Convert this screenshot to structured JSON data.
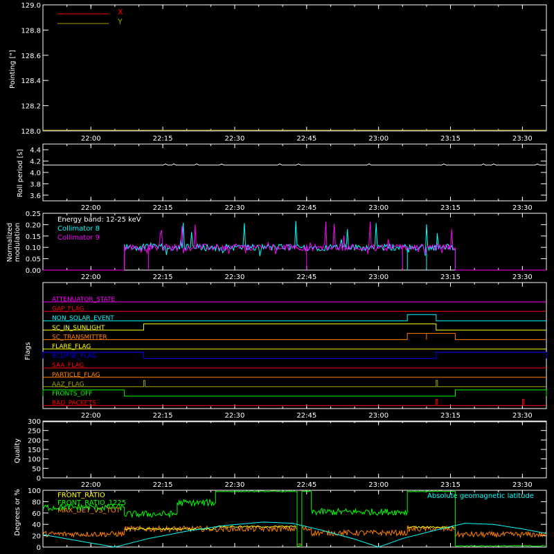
{
  "colors": {
    "background": "#000000",
    "axes": "#ffffff",
    "red": "#ff0000",
    "olive": "#a0a000",
    "cyan": "#00ffff",
    "magenta": "#ff00ff",
    "yellow": "#ffff00",
    "orange": "#ff8000",
    "blue": "#0000ff",
    "green": "#00ff00",
    "white": "#ffffff"
  },
  "time_axis": {
    "range": [
      "21:50",
      "23:35"
    ],
    "tick_labels": [
      "22:00",
      "22:15",
      "22:30",
      "22:45",
      "23:00",
      "23:15",
      "23:30"
    ]
  },
  "chart_data": [
    {
      "type": "line",
      "panel": "pointing",
      "ylabel": "Pointing [\"]",
      "ylim": [
        128.0,
        129.0
      ],
      "yticks": [
        "128.0",
        "128.2",
        "128.4",
        "128.6",
        "128.8",
        "129.0"
      ],
      "legend_placement": "top-left",
      "series": [
        {
          "name": "X",
          "color": "#ff0000",
          "points": []
        },
        {
          "name": "Y",
          "color": "#a0a000",
          "points": [
            [
              "21:50",
              128.0
            ],
            [
              "23:35",
              128.0
            ]
          ]
        }
      ]
    },
    {
      "type": "line",
      "panel": "roll",
      "ylabel": "Roll period [s]",
      "ylim": [
        3.5,
        4.5
      ],
      "yticks": [
        "3.6",
        "3.8",
        "4.0",
        "4.2",
        "4.4"
      ],
      "series": [
        {
          "name": "",
          "color": "#ffffff",
          "points": [
            [
              "21:50",
              4.13
            ],
            [
              "23:35",
              4.13
            ]
          ]
        }
      ]
    },
    {
      "type": "line",
      "panel": "modulation",
      "ylabel": [
        "Normalized",
        "modulation"
      ],
      "ylim": [
        0.0,
        0.25
      ],
      "yticks": [
        "0.00",
        "0.05",
        "0.10",
        "0.15",
        "0.20",
        "0.25"
      ],
      "annotation": "Energy band: 12-25 keV",
      "legend_placement": "top-left",
      "active_range": [
        "22:07",
        "23:16"
      ],
      "series": [
        {
          "name": "Collimator 8",
          "color": "#00ffff",
          "baseline": 0.1,
          "dropouts": [
            "23:06",
            "23:10"
          ]
        },
        {
          "name": "Collimator 9",
          "color": "#ff00ff",
          "baseline": 0.1,
          "dropouts": [
            "22:07",
            "22:12",
            "22:45",
            "23:05"
          ]
        }
      ]
    },
    {
      "type": "line",
      "panel": "flags",
      "ylabel": "Flags",
      "flags": [
        {
          "name": "ATTENUATOR_STATE",
          "color": "#ff00ff",
          "on": []
        },
        {
          "name": "GAP_FLAG",
          "color": "#ff0000",
          "on": []
        },
        {
          "name": "NON_SOLAR_EVENT",
          "color": "#00ffff",
          "on": [
            [
              "23:06",
              "23:12"
            ]
          ]
        },
        {
          "name": "SC_IN_SUNLIGHT",
          "color": "#ffff00",
          "on": [
            [
              "22:11",
              "23:12"
            ]
          ]
        },
        {
          "name": "SC_TRANSMITTER",
          "color": "#ff8000",
          "on": [
            [
              "23:06",
              "23:10"
            ],
            [
              "23:10",
              "23:16"
            ]
          ]
        },
        {
          "name": "FLARE_FLAG",
          "color": "#ffff00",
          "on": []
        },
        {
          "name": "ECLIPSE_FLAG",
          "color": "#0000ff",
          "on": [
            [
              "21:50",
              "22:11"
            ],
            [
              "23:12",
              "23:35"
            ]
          ]
        },
        {
          "name": "SAA_FLAG",
          "color": "#ff0000",
          "on": []
        },
        {
          "name": "PARTICLE_FLAG",
          "color": "#ff8000",
          "on": []
        },
        {
          "name": "AAZ_FLAG",
          "color": "#a0a000",
          "on": [
            [
              "22:11",
              "22:11"
            ],
            [
              "23:12",
              "23:12"
            ]
          ]
        },
        {
          "name": "FRONTS_OFF",
          "color": "#00ff00",
          "on": [
            [
              "21:50",
              "22:07"
            ],
            [
              "23:16",
              "23:35"
            ]
          ]
        },
        {
          "name": "BAD_PACKETS",
          "color": "#ff0000",
          "on": [
            [
              "23:12",
              "23:12"
            ],
            [
              "23:30",
              "23:30"
            ]
          ]
        }
      ]
    },
    {
      "type": "line",
      "panel": "quality",
      "ylabel": "Quality",
      "ylim": [
        0,
        300
      ],
      "yticks": [
        "0",
        "50",
        "100",
        "150",
        "200",
        "250",
        "300"
      ],
      "series": [
        {
          "name": "",
          "color": "#ffffff",
          "points": [
            [
              "21:50",
              300
            ],
            [
              "23:35",
              300
            ]
          ]
        }
      ]
    },
    {
      "type": "line",
      "panel": "ratios",
      "ylabel": "Degrees or %",
      "ylim": [
        0,
        100
      ],
      "yticks": [
        "0",
        "20",
        "40",
        "60",
        "80",
        "100"
      ],
      "legend_placement": "top-left",
      "annotation": "Absolute geomagnetic latitude",
      "series": [
        {
          "name": "FRONT_RATIO",
          "color": "#ffff00"
        },
        {
          "name": "FRONT_RATIO_1225",
          "color": "#00ff00",
          "points": [
            [
              "21:50",
              70
            ],
            [
              "22:07",
              70
            ],
            [
              "22:07",
              58
            ],
            [
              "22:18",
              60
            ],
            [
              "22:18",
              78
            ],
            [
              "22:26",
              78
            ],
            [
              "22:26",
              98
            ],
            [
              "22:43",
              98
            ],
            [
              "22:43",
              2
            ],
            [
              "22:44",
              2
            ],
            [
              "22:44",
              98
            ],
            [
              "22:46",
              98
            ],
            [
              "22:46",
              62
            ],
            [
              "23:06",
              62
            ],
            [
              "23:06",
              98
            ],
            [
              "23:16",
              98
            ],
            [
              "23:16",
              2
            ],
            [
              "23:35",
              2
            ]
          ]
        },
        {
          "name": "MAX_DET_VS_TOT",
          "color": "#ff8000",
          "points": [
            [
              "21:50",
              23
            ],
            [
              "22:07",
              23
            ],
            [
              "22:07",
              32
            ],
            [
              "22:43",
              32
            ],
            [
              "22:43",
              5
            ],
            [
              "22:44",
              5
            ],
            [
              "22:44",
              32
            ],
            [
              "22:46",
              32
            ],
            [
              "22:46",
              25
            ],
            [
              "23:06",
              25
            ],
            [
              "23:06",
              32
            ],
            [
              "23:16",
              32
            ],
            [
              "23:16",
              22
            ],
            [
              "23:35",
              22
            ]
          ]
        },
        {
          "name": "Absolute geomagnetic latitude",
          "color": "#00ffff",
          "points": [
            [
              "21:50",
              22
            ],
            [
              "21:58",
              10
            ],
            [
              "22:05",
              0
            ],
            [
              "22:12",
              15
            ],
            [
              "22:20",
              28
            ],
            [
              "22:28",
              38
            ],
            [
              "22:36",
              44
            ],
            [
              "22:42",
              42
            ],
            [
              "22:48",
              30
            ],
            [
              "22:55",
              14
            ],
            [
              "23:00",
              0
            ],
            [
              "23:05",
              15
            ],
            [
              "23:12",
              30
            ],
            [
              "23:18",
              42
            ],
            [
              "23:24",
              40
            ],
            [
              "23:30",
              32
            ],
            [
              "23:35",
              24
            ]
          ]
        }
      ]
    }
  ]
}
